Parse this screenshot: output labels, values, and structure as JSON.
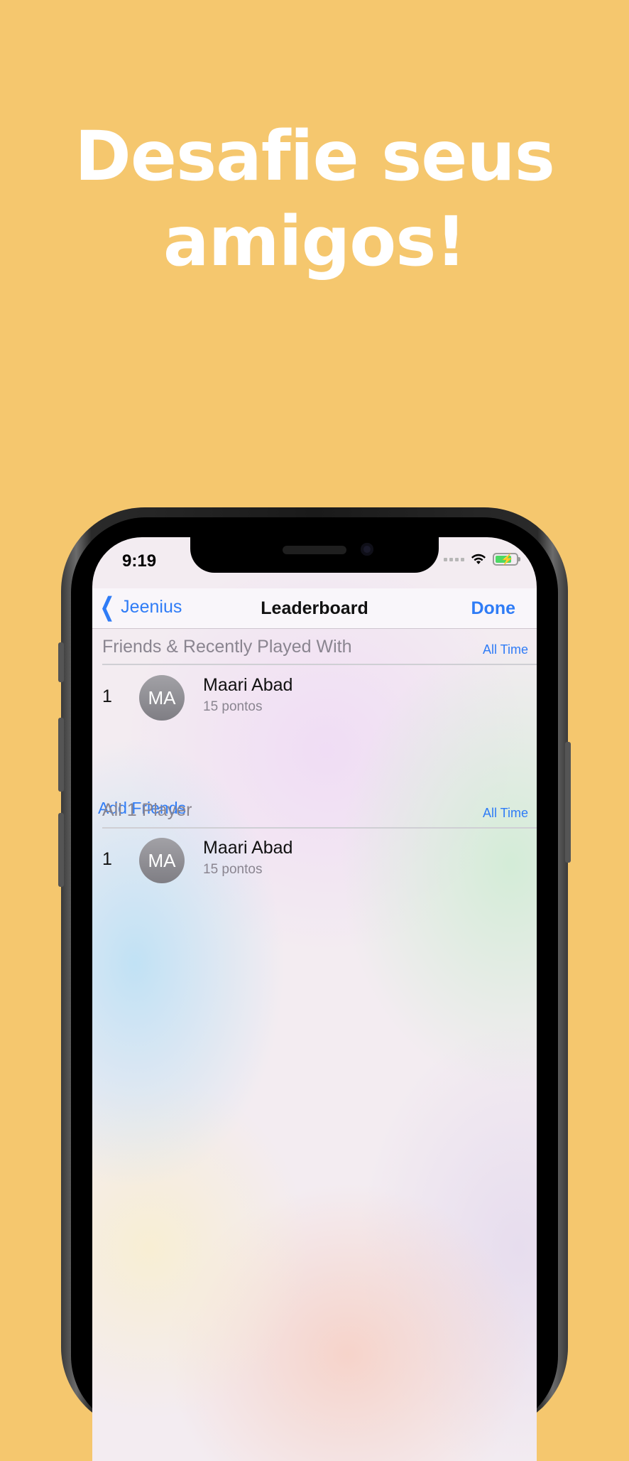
{
  "headline": {
    "line1": "Desafie seus",
    "line2": "amigos!"
  },
  "status_bar": {
    "time": "9:19"
  },
  "navbar": {
    "back_label": "Jeenius",
    "title": "Leaderboard",
    "done_label": "Done"
  },
  "sections": [
    {
      "title": "Friends & Recently Played With",
      "filter": "All Time",
      "rows": [
        {
          "rank": "1",
          "initials": "MA",
          "name": "Maari Abad",
          "score": "15 pontos"
        }
      ]
    },
    {
      "title": "All 1 Player",
      "filter": "All Time",
      "rows": [
        {
          "rank": "1",
          "initials": "MA",
          "name": "Maari Abad",
          "score": "15 pontos"
        }
      ]
    }
  ],
  "add_friends_label": "Add Friends",
  "colors": {
    "background": "#f5c76e",
    "accent": "#2f7cf6",
    "battery": "#4cd964"
  }
}
